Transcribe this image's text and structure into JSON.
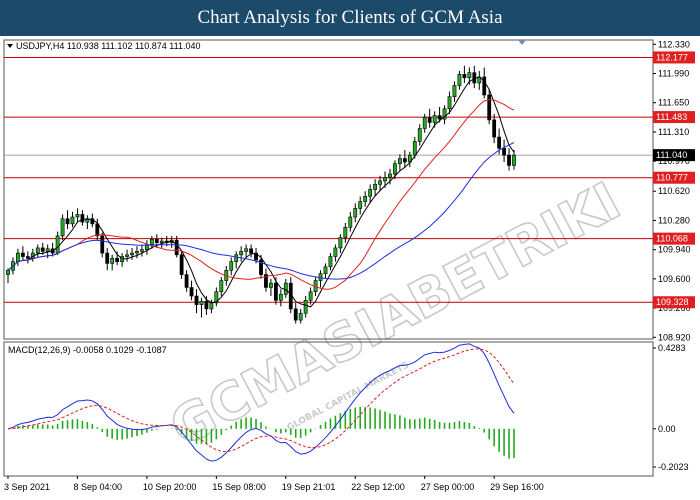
{
  "header": {
    "title": "Chart Analysis for Clients of GCM Asia"
  },
  "watermark": {
    "main": "GCMASIABETRIKI",
    "sub": "GLOBAL CAPITAL MARKETS"
  },
  "chart_data": {
    "type": "candlestick",
    "symbol_info": "USDJPY,H4  110.938 111.102 110.874 111.040",
    "price_axis": {
      "range": [
        108.9,
        112.38
      ],
      "ticks": [
        "112.330",
        "111.990",
        "111.650",
        "111.310",
        "110.970",
        "110.620",
        "110.280",
        "109.940",
        "109.600",
        "109.260",
        "108.920"
      ],
      "tick_values": [
        112.33,
        111.99,
        111.65,
        111.31,
        110.97,
        110.62,
        110.28,
        109.94,
        109.6,
        109.26,
        108.92
      ]
    },
    "current_price": "111.040",
    "horizontal_levels": [
      "112.177",
      "111.483",
      "110.777",
      "110.068",
      "109.328"
    ],
    "time_labels": [
      "3 Sep 2021",
      "8 Sep 04:00",
      "10 Sep 20:00",
      "15 Sep 08:00",
      "19 Sep 21:01",
      "22 Sep 12:00",
      "27 Sep 00:00",
      "29 Sep 16:00"
    ],
    "time_label_index": [
      0,
      14,
      28,
      42,
      56,
      70,
      84,
      98
    ],
    "candles": [
      [
        109.65,
        109.72,
        109.55,
        109.7
      ],
      [
        109.7,
        109.85,
        109.65,
        109.8
      ],
      [
        109.8,
        109.95,
        109.75,
        109.9
      ],
      [
        109.9,
        109.98,
        109.82,
        109.86
      ],
      [
        109.86,
        109.92,
        109.78,
        109.84
      ],
      [
        109.84,
        109.95,
        109.8,
        109.9
      ],
      [
        109.9,
        110.0,
        109.85,
        109.96
      ],
      [
        109.96,
        110.02,
        109.88,
        109.92
      ],
      [
        109.92,
        110.0,
        109.84,
        109.95
      ],
      [
        109.95,
        110.02,
        109.86,
        109.9
      ],
      [
        109.9,
        110.15,
        109.88,
        110.1
      ],
      [
        110.1,
        110.35,
        110.05,
        110.3
      ],
      [
        110.3,
        110.4,
        110.18,
        110.24
      ],
      [
        110.24,
        110.38,
        110.2,
        110.32
      ],
      [
        110.32,
        110.42,
        110.25,
        110.35
      ],
      [
        110.35,
        110.4,
        110.22,
        110.26
      ],
      [
        110.26,
        110.34,
        110.18,
        110.3
      ],
      [
        110.3,
        110.36,
        110.2,
        110.24
      ],
      [
        110.24,
        110.3,
        110.05,
        110.1
      ],
      [
        110.1,
        110.14,
        109.85,
        109.9
      ],
      [
        109.9,
        109.96,
        109.7,
        109.78
      ],
      [
        109.78,
        109.88,
        109.7,
        109.84
      ],
      [
        109.84,
        109.92,
        109.76,
        109.8
      ],
      [
        109.8,
        109.9,
        109.74,
        109.86
      ],
      [
        109.86,
        109.94,
        109.8,
        109.88
      ],
      [
        109.88,
        109.96,
        109.82,
        109.9
      ],
      [
        109.9,
        109.98,
        109.84,
        109.92
      ],
      [
        109.92,
        110.0,
        109.86,
        109.94
      ],
      [
        109.94,
        110.05,
        109.88,
        110.0
      ],
      [
        110.0,
        110.1,
        109.95,
        110.06
      ],
      [
        110.06,
        110.12,
        109.96,
        110.02
      ],
      [
        110.02,
        110.08,
        109.96,
        110.04
      ],
      [
        110.04,
        110.1,
        109.98,
        110.02
      ],
      [
        110.02,
        110.1,
        109.96,
        110.05
      ],
      [
        110.05,
        110.1,
        109.85,
        109.88
      ],
      [
        109.88,
        109.92,
        109.6,
        109.65
      ],
      [
        109.65,
        109.7,
        109.45,
        109.5
      ],
      [
        109.5,
        109.58,
        109.35,
        109.4
      ],
      [
        109.4,
        109.48,
        109.2,
        109.3
      ],
      [
        109.3,
        109.38,
        109.15,
        109.34
      ],
      [
        109.34,
        109.4,
        109.18,
        109.25
      ],
      [
        109.25,
        109.36,
        109.2,
        109.32
      ],
      [
        109.32,
        109.5,
        109.28,
        109.45
      ],
      [
        109.45,
        109.62,
        109.4,
        109.58
      ],
      [
        109.58,
        109.75,
        109.52,
        109.7
      ],
      [
        109.7,
        109.85,
        109.64,
        109.8
      ],
      [
        109.8,
        109.92,
        109.72,
        109.88
      ],
      [
        109.88,
        109.98,
        109.8,
        109.92
      ],
      [
        109.92,
        110.0,
        109.84,
        109.95
      ],
      [
        109.95,
        110.0,
        109.85,
        109.9
      ],
      [
        109.9,
        109.96,
        109.78,
        109.82
      ],
      [
        109.82,
        109.88,
        109.6,
        109.65
      ],
      [
        109.65,
        109.72,
        109.45,
        109.5
      ],
      [
        109.5,
        109.6,
        109.4,
        109.55
      ],
      [
        109.55,
        109.62,
        109.3,
        109.35
      ],
      [
        109.35,
        109.48,
        109.28,
        109.42
      ],
      [
        109.42,
        109.6,
        109.38,
        109.55
      ],
      [
        109.55,
        109.62,
        109.2,
        109.25
      ],
      [
        109.25,
        109.32,
        109.08,
        109.12
      ],
      [
        109.12,
        109.25,
        109.08,
        109.2
      ],
      [
        109.2,
        109.4,
        109.15,
        109.35
      ],
      [
        109.35,
        109.5,
        109.3,
        109.45
      ],
      [
        109.45,
        109.62,
        109.4,
        109.58
      ],
      [
        109.58,
        109.7,
        109.5,
        109.66
      ],
      [
        109.66,
        109.78,
        109.6,
        109.74
      ],
      [
        109.74,
        109.9,
        109.7,
        109.86
      ],
      [
        109.86,
        110.0,
        109.8,
        109.96
      ],
      [
        109.96,
        110.12,
        109.9,
        110.08
      ],
      [
        110.08,
        110.25,
        110.02,
        110.2
      ],
      [
        110.2,
        110.38,
        110.15,
        110.32
      ],
      [
        110.32,
        110.48,
        110.26,
        110.42
      ],
      [
        110.42,
        110.56,
        110.35,
        110.5
      ],
      [
        110.5,
        110.62,
        110.44,
        110.56
      ],
      [
        110.56,
        110.7,
        110.48,
        110.64
      ],
      [
        110.64,
        110.76,
        110.56,
        110.7
      ],
      [
        110.7,
        110.8,
        110.62,
        110.74
      ],
      [
        110.74,
        110.85,
        110.66,
        110.78
      ],
      [
        110.78,
        110.88,
        110.7,
        110.82
      ],
      [
        110.82,
        110.98,
        110.76,
        110.94
      ],
      [
        110.94,
        111.05,
        110.86,
        111.0
      ],
      [
        111.0,
        111.1,
        110.9,
        110.96
      ],
      [
        110.96,
        111.08,
        110.9,
        111.04
      ],
      [
        111.04,
        111.25,
        111.0,
        111.2
      ],
      [
        111.2,
        111.4,
        111.15,
        111.35
      ],
      [
        111.35,
        111.52,
        111.3,
        111.48
      ],
      [
        111.48,
        111.58,
        111.36,
        111.42
      ],
      [
        111.42,
        111.55,
        111.36,
        111.5
      ],
      [
        111.5,
        111.6,
        111.42,
        111.46
      ],
      [
        111.46,
        111.62,
        111.4,
        111.58
      ],
      [
        111.58,
        111.78,
        111.52,
        111.72
      ],
      [
        111.72,
        111.9,
        111.66,
        111.85
      ],
      [
        111.85,
        112.02,
        111.8,
        111.98
      ],
      [
        111.98,
        112.08,
        111.88,
        111.94
      ],
      [
        111.94,
        112.06,
        111.86,
        112.0
      ],
      [
        112.0,
        112.08,
        111.82,
        111.88
      ],
      [
        111.88,
        112.02,
        111.8,
        111.95
      ],
      [
        111.95,
        112.06,
        111.7,
        111.74
      ],
      [
        111.74,
        111.8,
        111.4,
        111.45
      ],
      [
        111.45,
        111.52,
        111.18,
        111.25
      ],
      [
        111.25,
        111.35,
        111.05,
        111.12
      ],
      [
        111.12,
        111.22,
        110.96,
        111.04
      ],
      [
        111.04,
        111.12,
        110.86,
        110.92
      ],
      [
        110.92,
        111.1,
        110.87,
        111.04
      ]
    ],
    "macd": {
      "label": "MACD(12,26,9) -0.0058 0.1029 -0.1087",
      "axis_ticks": [
        "0.4283",
        "0.00",
        "-0.2023"
      ],
      "axis_values": [
        0.4283,
        0.0,
        -0.2023
      ],
      "range": [
        -0.25,
        0.46
      ]
    },
    "colors": {
      "sma_short": "#000000",
      "sma_mid": "#e02020",
      "sma_long": "#1e2ee0",
      "level_line": "#c00000",
      "level_tag": "#e02020",
      "macd_line": "#1e2ee0",
      "signal_line": "#e02020",
      "histogram": "#22aa22"
    }
  }
}
